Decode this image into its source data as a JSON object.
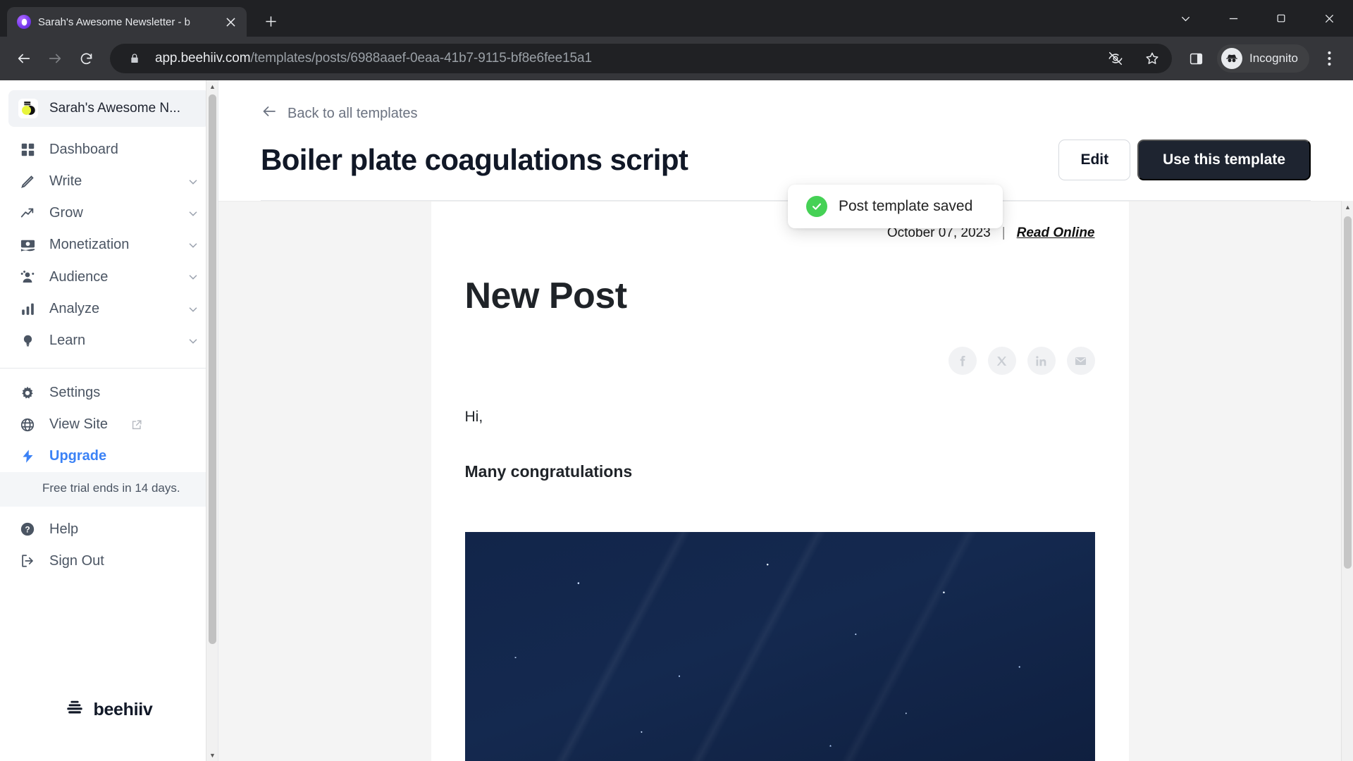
{
  "browser": {
    "tab": {
      "title": "Sarah's Awesome Newsletter - b",
      "favicon": "beehiiv-favicon",
      "close_label": "×"
    },
    "new_tab_label": "+",
    "window_controls": {
      "minimize": "minimize-icon",
      "maximize": "maximize-icon",
      "close": "close-icon",
      "chevron": "chevron-down-icon"
    },
    "nav": {
      "back": "back-arrow-icon",
      "forward": "forward-arrow-icon",
      "reload": "reload-icon"
    },
    "omnibox": {
      "lock": "lock-icon",
      "url_host": "app.beehiiv.com",
      "url_path": "/templates/posts/6988aaef-0eaa-41b7-9115-bf8e6fee15a1",
      "full_url": "app.beehiiv.com/templates/posts/6988aaef-0eaa-41b7-9115-bf8e6fee15a1"
    },
    "toolbar_icons": [
      "eye-off-icon",
      "star-bookmark-icon",
      "side-panel-icon"
    ],
    "profile": {
      "label": "Incognito",
      "icon": "incognito-icon"
    },
    "menu": "three-dot-menu-icon"
  },
  "sidebar": {
    "workspace": {
      "name": "Sarah's Awesome N...",
      "logo": "beehiiv-workspace-logo"
    },
    "items": [
      {
        "label": "Dashboard",
        "icon": "grid-dashboard-icon",
        "expandable": false
      },
      {
        "label": "Write",
        "icon": "pencil-icon",
        "expandable": true
      },
      {
        "label": "Grow",
        "icon": "trend-up-icon",
        "expandable": true
      },
      {
        "label": "Monetization",
        "icon": "money-icon",
        "expandable": true
      },
      {
        "label": "Audience",
        "icon": "people-icon",
        "expandable": true
      },
      {
        "label": "Analyze",
        "icon": "bar-chart-icon",
        "expandable": true
      },
      {
        "label": "Learn",
        "icon": "lightbulb-icon",
        "expandable": true
      }
    ],
    "secondary_items": [
      {
        "label": "Settings",
        "icon": "gear-icon",
        "external": false
      },
      {
        "label": "View Site",
        "icon": "globe-icon",
        "external": true
      },
      {
        "label": "Upgrade",
        "icon": "lightning-bolt-icon",
        "external": false,
        "accent": true
      }
    ],
    "trial_notice": "Free trial ends in 14 days.",
    "footer_items": [
      {
        "label": "Help",
        "icon": "question-circle-icon"
      },
      {
        "label": "Sign Out",
        "icon": "sign-out-icon"
      }
    ],
    "brand": {
      "text": "beehiiv",
      "icon": "beehiiv-hive-icon"
    }
  },
  "main": {
    "back_link": "Back to all templates",
    "back_icon": "arrow-left-icon",
    "title": "Boiler plate coagulations script",
    "buttons": {
      "edit": "Edit",
      "use_template": "Use this template"
    }
  },
  "toast": {
    "message": "Post template saved",
    "icon": "check-circle-icon",
    "color": "#45d155"
  },
  "preview": {
    "date": "October 07, 2023",
    "separator": "|",
    "read_online": "Read Online",
    "heading": "New Post",
    "socials": [
      {
        "name": "facebook-icon",
        "glyph": "f"
      },
      {
        "name": "x-twitter-icon",
        "glyph": "𝕏"
      },
      {
        "name": "linkedin-icon",
        "glyph": "in"
      },
      {
        "name": "email-icon",
        "glyph": "✉"
      }
    ],
    "greeting": "Hi,",
    "bold_line": "Many congratulations",
    "hero_image_alt": "night-sky-stars-image"
  },
  "colors": {
    "accent_blue": "#3b82f6",
    "primary_dark": "#1e2430",
    "toast_green": "#45d155",
    "browser_chrome": "#35363a",
    "tabstrip": "#202124"
  }
}
